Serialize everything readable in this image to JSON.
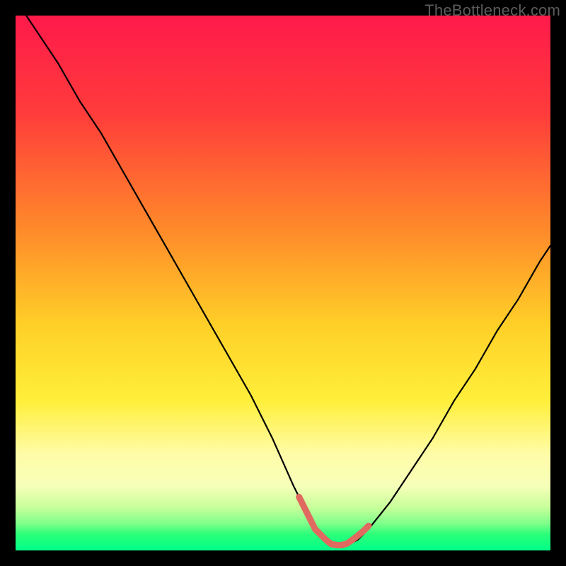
{
  "watermark": "TheBottleneck.com",
  "chart_data": {
    "type": "line",
    "title": "",
    "xlabel": "",
    "ylabel": "",
    "xlim": [
      0,
      100
    ],
    "ylim": [
      0,
      100
    ],
    "gradient_stops": [
      {
        "offset": 0,
        "color": "#ff1a4b"
      },
      {
        "offset": 18,
        "color": "#ff3b3b"
      },
      {
        "offset": 40,
        "color": "#ff8a2a"
      },
      {
        "offset": 58,
        "color": "#ffd028"
      },
      {
        "offset": 72,
        "color": "#ffef3a"
      },
      {
        "offset": 82,
        "color": "#fffca8"
      },
      {
        "offset": 88,
        "color": "#f6ffb8"
      },
      {
        "offset": 92,
        "color": "#c7ff9a"
      },
      {
        "offset": 95,
        "color": "#7dff8a"
      },
      {
        "offset": 97,
        "color": "#2bff7a"
      },
      {
        "offset": 100,
        "color": "#00ff88"
      }
    ],
    "series": [
      {
        "name": "bottleneck-curve",
        "color": "#000000",
        "x": [
          0,
          4,
          8,
          12,
          16,
          20,
          24,
          28,
          32,
          36,
          40,
          44,
          48,
          52,
          54,
          56,
          58,
          60,
          62,
          64,
          66,
          70,
          74,
          78,
          82,
          86,
          90,
          94,
          98,
          100
        ],
        "y": [
          103,
          97,
          91,
          84,
          78,
          71,
          64,
          57,
          50,
          43,
          36,
          29,
          21,
          12,
          8,
          4,
          2,
          1,
          1,
          2,
          4,
          9,
          15,
          21,
          28,
          34,
          41,
          47,
          54,
          57
        ]
      }
    ],
    "highlight": {
      "name": "valley-highlight",
      "color": "#e06a60",
      "stroke_width": 9,
      "x": [
        53,
        54,
        55,
        56,
        57,
        58,
        59,
        60,
        61,
        62,
        63,
        64,
        65,
        66
      ],
      "y": [
        10,
        8,
        6,
        4,
        3,
        2,
        1.2,
        1,
        1,
        1.3,
        2,
        2.8,
        3.6,
        4.6
      ]
    }
  }
}
